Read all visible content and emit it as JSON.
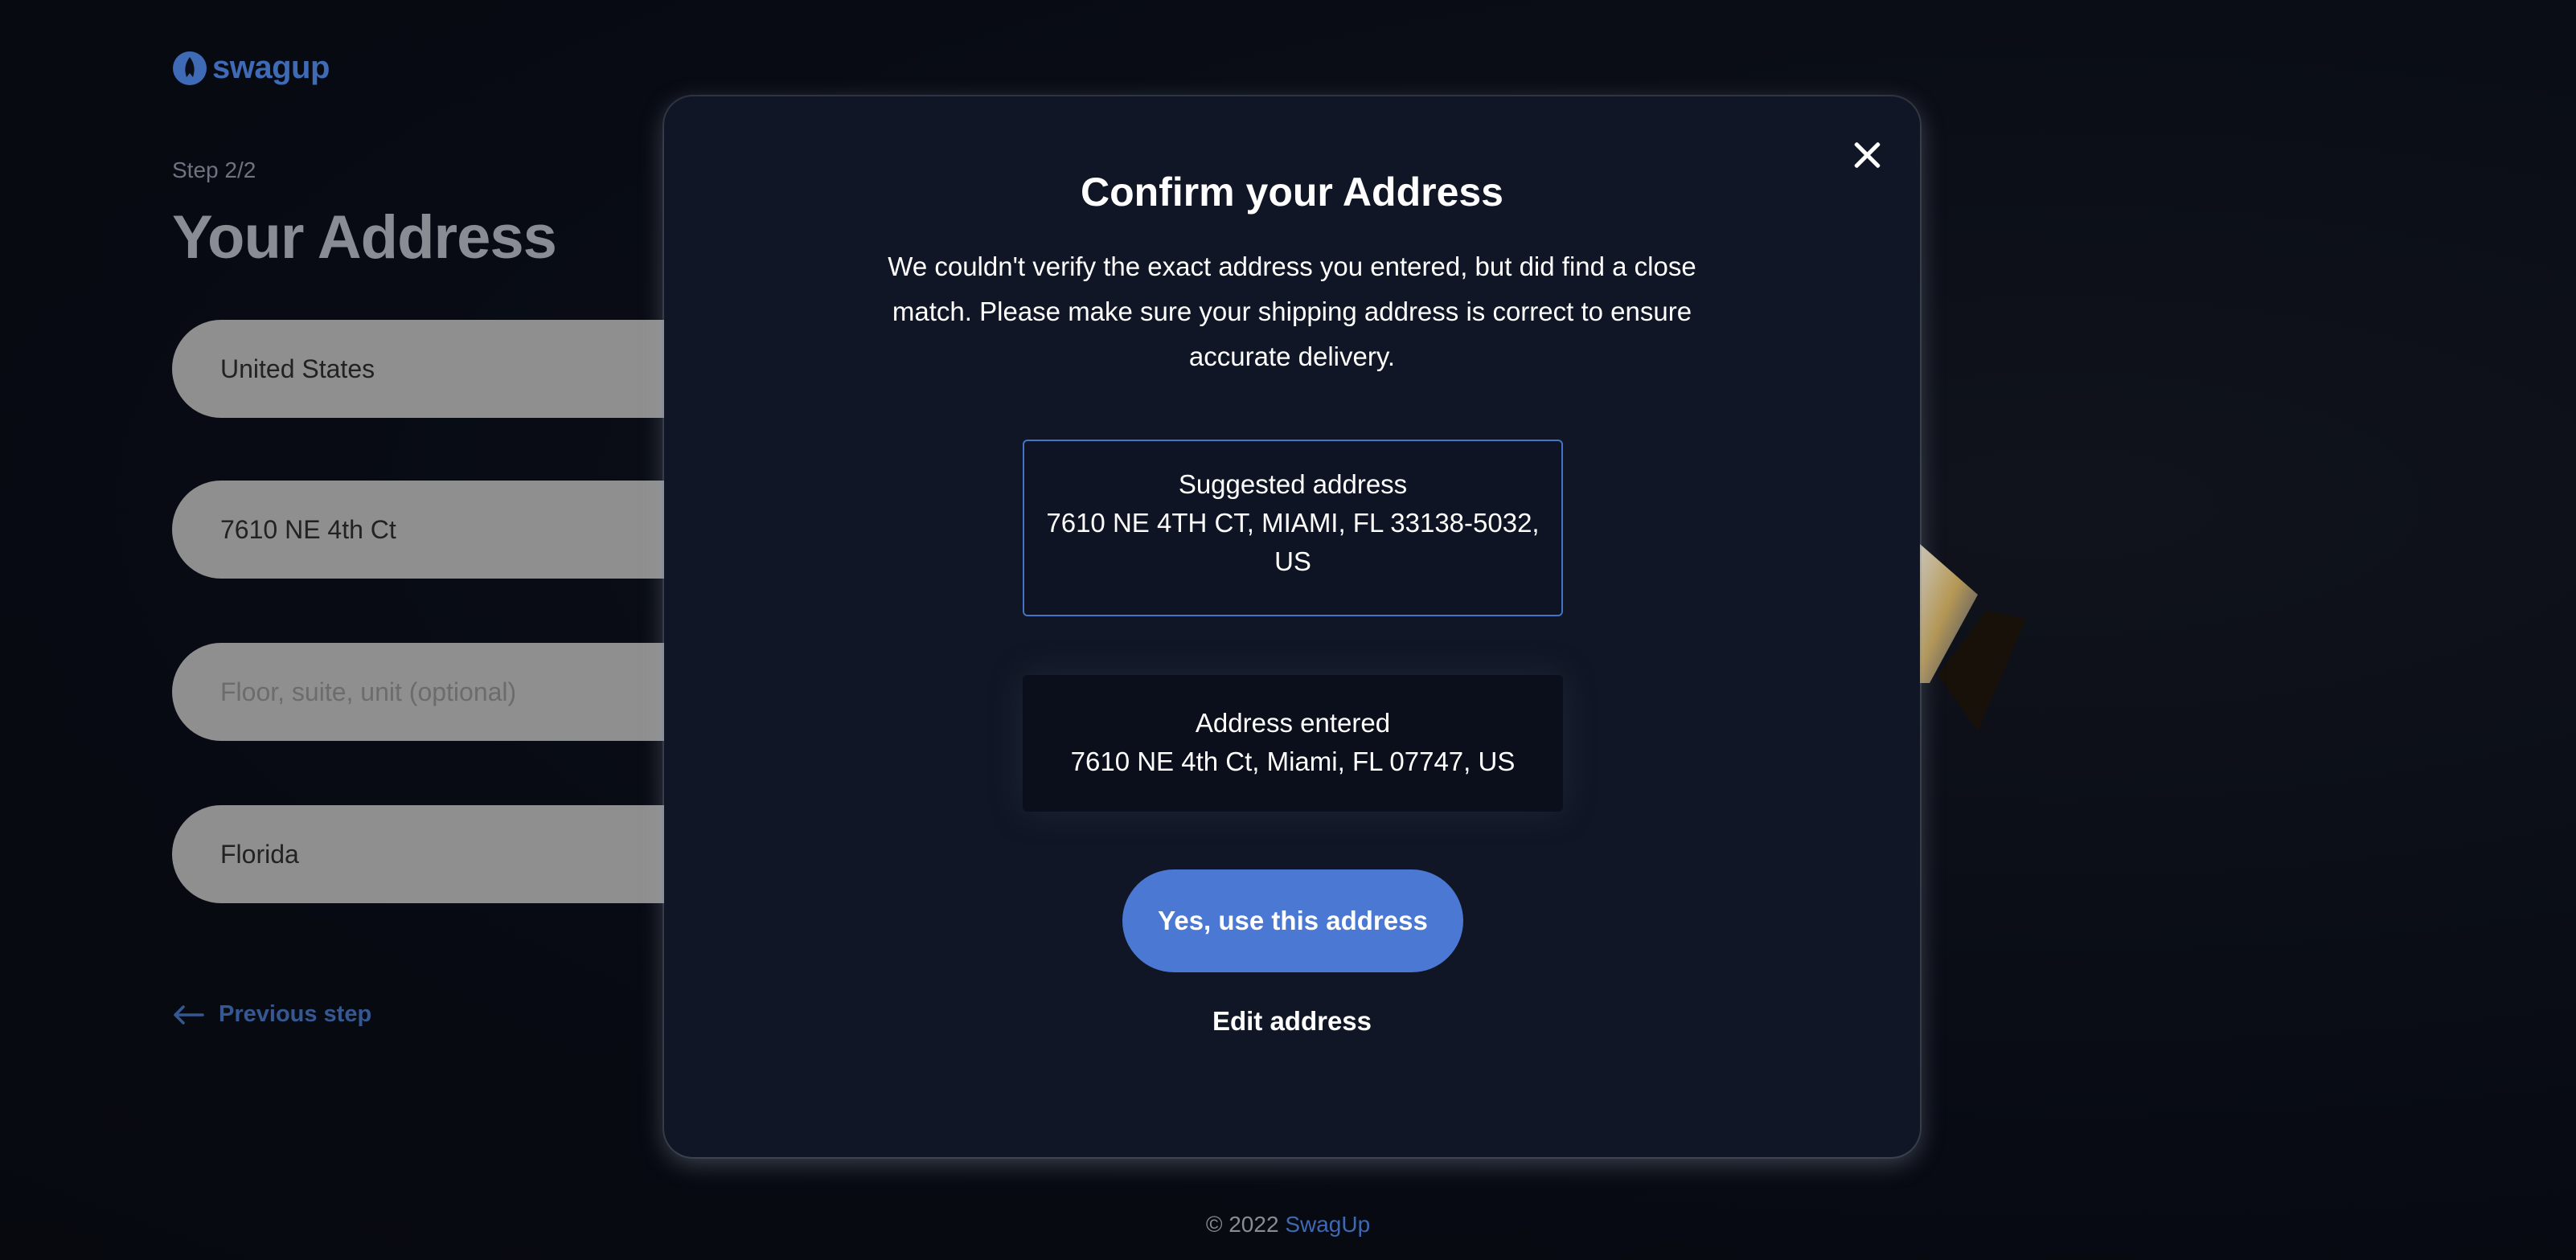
{
  "brand": {
    "logo_text": "swagup",
    "logo_color": "#3f6ab5"
  },
  "form": {
    "step": "Step 2/2",
    "title": "Your Address",
    "country": "United States",
    "street": "7610 NE 4th Ct",
    "unit_placeholder": "Floor, suite, unit (optional)",
    "state": "Florida",
    "previous_step": "Previous step"
  },
  "modal": {
    "title": "Confirm your Address",
    "description": "We couldn't verify the exact address you entered, but did find a close match. Please make sure your shipping address is correct to ensure accurate delivery.",
    "suggested": {
      "label": "Suggested address",
      "address_line1": "7610 NE 4TH CT, MIAMI, FL 33138-5032,",
      "address_line2": "US"
    },
    "entered": {
      "label": "Address entered",
      "address": "7610 NE 4th Ct, Miami, FL 07747, US"
    },
    "confirm_button": "Yes, use this address",
    "edit_link": "Edit address"
  },
  "footer": {
    "copyright": "© 2022 ",
    "brand": "SwagUp"
  },
  "colors": {
    "accent": "#4a78d2",
    "background": "#090d18",
    "modal_bg": "#101625"
  }
}
